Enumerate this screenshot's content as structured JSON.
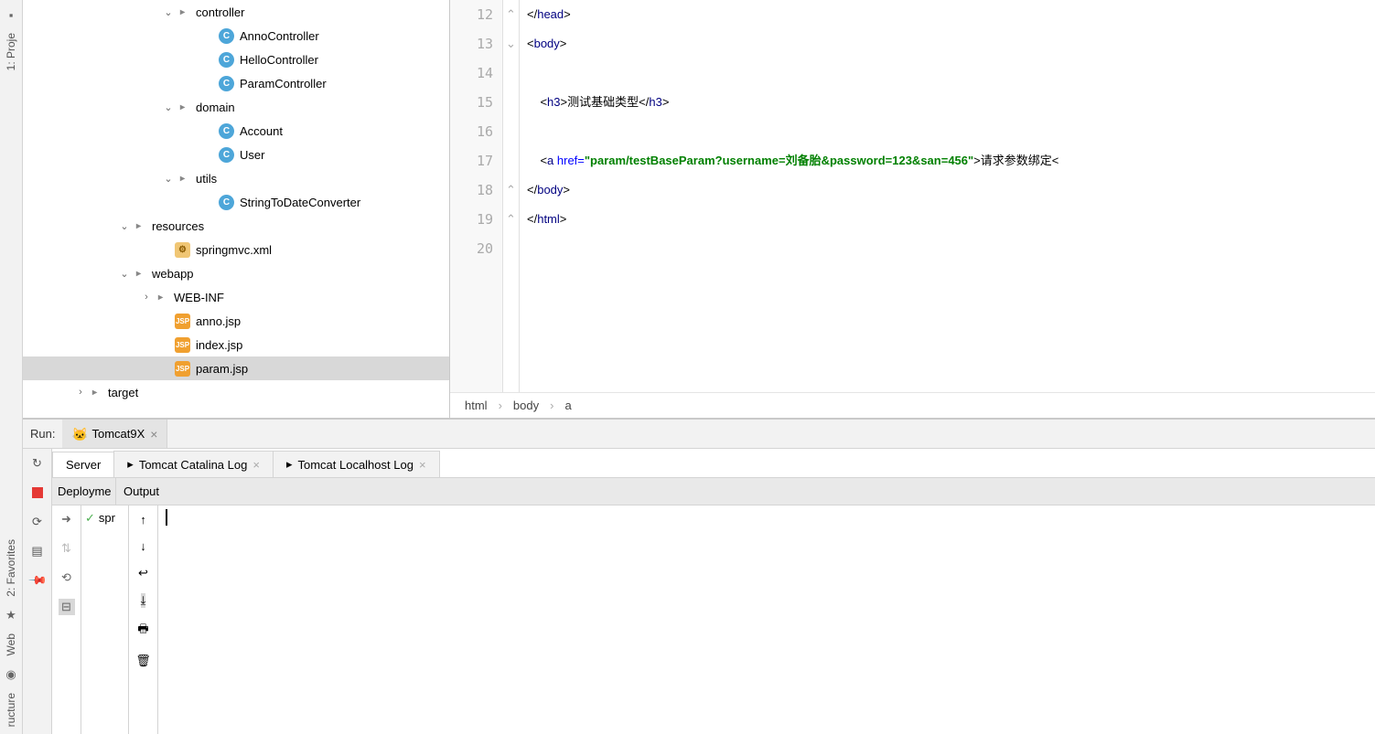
{
  "leftRail": {
    "project": "1: Proje",
    "favorites": "2: Favorites",
    "web": "Web",
    "structure": "ructure"
  },
  "tree": [
    {
      "indent": 152,
      "chev": "down",
      "iconType": "folder",
      "name": "controller",
      "label": "controller"
    },
    {
      "indent": 200,
      "chev": "none",
      "iconType": "class",
      "name": "anno-controller",
      "label": "AnnoController"
    },
    {
      "indent": 200,
      "chev": "none",
      "iconType": "class",
      "name": "hello-controller",
      "label": "HelloController"
    },
    {
      "indent": 200,
      "chev": "none",
      "iconType": "class",
      "name": "param-controller",
      "label": "ParamController"
    },
    {
      "indent": 152,
      "chev": "down",
      "iconType": "folder",
      "name": "domain",
      "label": "domain"
    },
    {
      "indent": 200,
      "chev": "none",
      "iconType": "class",
      "name": "account",
      "label": "Account"
    },
    {
      "indent": 200,
      "chev": "none",
      "iconType": "class",
      "name": "user",
      "label": "User"
    },
    {
      "indent": 152,
      "chev": "down",
      "iconType": "folder",
      "name": "utils",
      "label": "utils"
    },
    {
      "indent": 200,
      "chev": "none",
      "iconType": "class",
      "name": "string-to-date-converter",
      "label": "StringToDateConverter"
    },
    {
      "indent": 104,
      "chev": "down",
      "iconType": "folder",
      "name": "resources",
      "label": "resources"
    },
    {
      "indent": 152,
      "chev": "none",
      "iconType": "xml",
      "name": "springmvc-xml",
      "label": "springmvc.xml"
    },
    {
      "indent": 104,
      "chev": "down",
      "iconType": "folder",
      "name": "webapp",
      "label": "webapp"
    },
    {
      "indent": 128,
      "chev": "right",
      "iconType": "folder",
      "name": "web-inf",
      "label": "WEB-INF"
    },
    {
      "indent": 152,
      "chev": "none",
      "iconType": "jsp",
      "name": "anno-jsp",
      "label": "anno.jsp"
    },
    {
      "indent": 152,
      "chev": "none",
      "iconType": "jsp",
      "name": "index-jsp",
      "label": "index.jsp"
    },
    {
      "indent": 152,
      "chev": "none",
      "iconType": "jsp",
      "name": "param-jsp",
      "label": "param.jsp",
      "selected": true
    },
    {
      "indent": 56,
      "chev": "right",
      "iconType": "folder",
      "name": "target",
      "label": "target"
    }
  ],
  "editor": {
    "lines": [
      {
        "num": 12,
        "fold": "up",
        "tokens": [
          {
            "t": "brk",
            "v": "</"
          },
          {
            "t": "tag",
            "v": "head"
          },
          {
            "t": "brk",
            "v": ">"
          }
        ]
      },
      {
        "num": 13,
        "fold": "dn",
        "tokens": [
          {
            "t": "brk",
            "v": "<"
          },
          {
            "t": "tag",
            "v": "body"
          },
          {
            "t": "brk",
            "v": ">"
          }
        ]
      },
      {
        "num": 14,
        "fold": "",
        "tokens": []
      },
      {
        "num": 15,
        "fold": "",
        "tokens": [
          {
            "t": "txt",
            "v": "    "
          },
          {
            "t": "brk",
            "v": "<"
          },
          {
            "t": "tag",
            "v": "h3"
          },
          {
            "t": "brk",
            "v": ">"
          },
          {
            "t": "txt",
            "v": "测试基础类型"
          },
          {
            "t": "brk",
            "v": "</"
          },
          {
            "t": "tag",
            "v": "h3"
          },
          {
            "t": "brk",
            "v": ">"
          }
        ]
      },
      {
        "num": 16,
        "fold": "",
        "tokens": []
      },
      {
        "num": 17,
        "fold": "",
        "tokens": [
          {
            "t": "txt",
            "v": "    "
          },
          {
            "t": "brk",
            "v": "<"
          },
          {
            "t": "tag",
            "v": "a "
          },
          {
            "t": "attr",
            "v": "href="
          },
          {
            "t": "str",
            "v": "\"param/testBaseParam?username=刘备胎&password=123&san=456\""
          },
          {
            "t": "brk",
            "v": ">"
          },
          {
            "t": "txt",
            "v": "请求参数绑定<"
          }
        ]
      },
      {
        "num": 18,
        "fold": "up",
        "tokens": [
          {
            "t": "brk",
            "v": "</"
          },
          {
            "t": "tag",
            "v": "body"
          },
          {
            "t": "brk",
            "v": ">"
          }
        ]
      },
      {
        "num": 19,
        "fold": "up",
        "tokens": [
          {
            "t": "brk",
            "v": "</"
          },
          {
            "t": "tag",
            "v": "html"
          },
          {
            "t": "brk",
            "v": ">"
          }
        ]
      },
      {
        "num": 20,
        "fold": "",
        "tokens": []
      }
    ]
  },
  "breadcrumb": {
    "a": "html",
    "b": "body",
    "c": "a"
  },
  "run": {
    "label": "Run:",
    "config": "Tomcat9X",
    "tabs": {
      "server": "Server",
      "catalina": "Tomcat Catalina Log",
      "localhost": "Tomcat Localhost Log"
    },
    "columns": {
      "deployment": "Deployme",
      "output": "Output"
    },
    "depItem": "spr"
  }
}
